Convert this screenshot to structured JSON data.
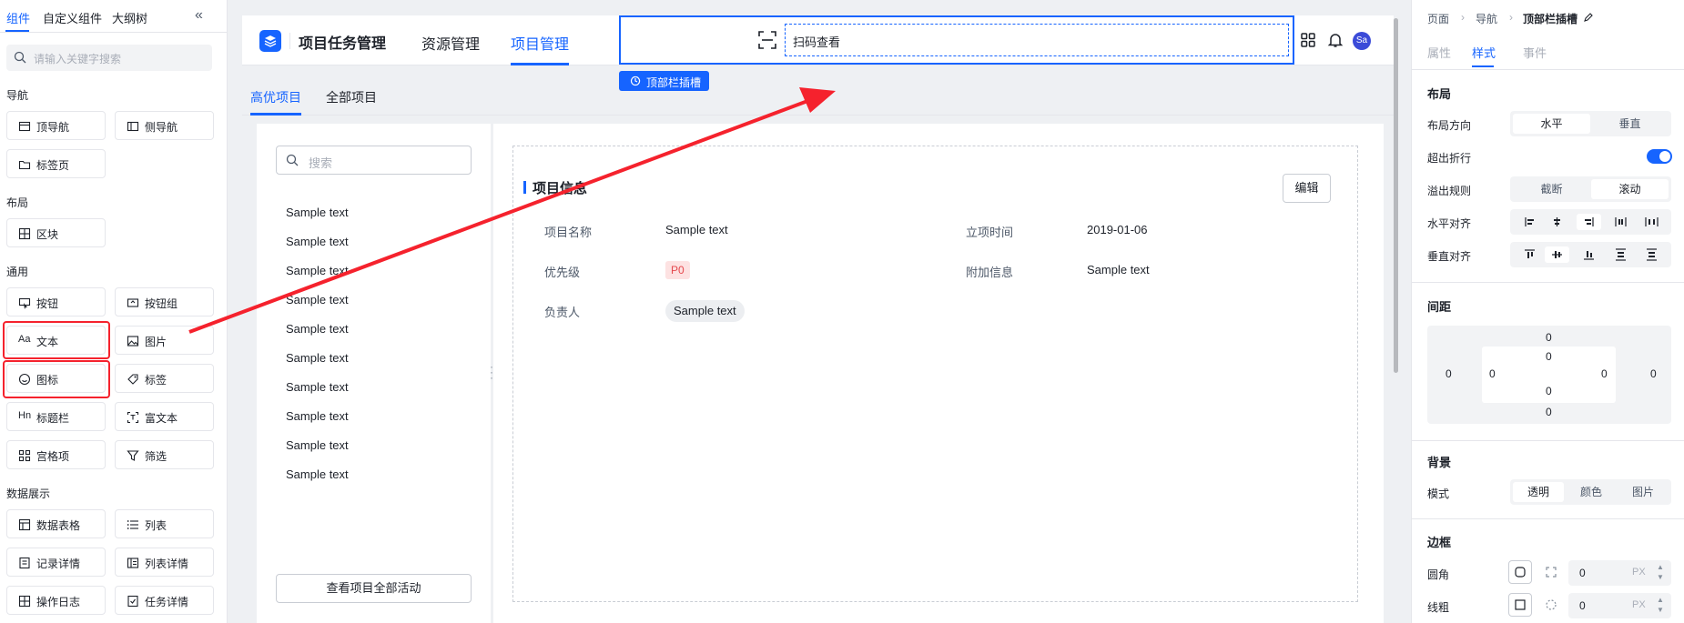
{
  "left_panel": {
    "tabs": [
      "组件",
      "自定义组件",
      "大纲树"
    ],
    "search_placeholder": "请输入关键字搜索",
    "sections": {
      "nav": "导航",
      "layout": "布局",
      "general": "通用",
      "data_display": "数据展示"
    },
    "components": {
      "top_nav": "顶导航",
      "side_nav": "侧导航",
      "tab_page": "标签页",
      "block": "区块",
      "button": "按钮",
      "button_group": "按钮组",
      "text": "文本",
      "image": "图片",
      "icon": "图标",
      "tag": "标签",
      "title_bar": "标题栏",
      "rich_text": "富文本",
      "grid_item": "宫格项",
      "filter": "筛选",
      "data_table": "数据表格",
      "list": "列表",
      "record_detail": "记录详情",
      "list_detail": "列表详情",
      "op_log": "操作日志",
      "task_detail": "任务详情"
    }
  },
  "header": {
    "app_title": "项目任务管理",
    "nav": [
      "资源管理",
      "项目管理"
    ],
    "scan_text": "扫码查看",
    "avatar": "Sa",
    "slot_tag": "顶部栏插槽"
  },
  "content_tabs": [
    "高优项目",
    "全部项目"
  ],
  "list_panel": {
    "search_placeholder": "搜索",
    "items": [
      "Sample text",
      "Sample text",
      "Sample text",
      "Sample text",
      "Sample text",
      "Sample text",
      "Sample text",
      "Sample text",
      "Sample text",
      "Sample text"
    ],
    "all_button": "查看项目全部活动"
  },
  "detail": {
    "section_title": "项目信息",
    "edit": "编辑",
    "fields": {
      "name_label": "项目名称",
      "name_value": "Sample text",
      "date_label": "立项时间",
      "date_value": "2019-01-06",
      "priority_label": "优先级",
      "priority_value": "P0",
      "extra_label": "附加信息",
      "extra_value": "Sample text",
      "owner_label": "负责人",
      "owner_value": "Sample text"
    }
  },
  "right_panel": {
    "breadcrumb": [
      "页面",
      "导航",
      "顶部栏插槽"
    ],
    "tabs": [
      "属性",
      "样式",
      "事件"
    ],
    "layout": {
      "title": "布局",
      "direction_label": "布局方向",
      "direction_options": [
        "水平",
        "垂直"
      ],
      "wrap_label": "超出折行",
      "wrap_on": true,
      "overflow_label": "溢出规则",
      "overflow_options": [
        "截断",
        "滚动"
      ],
      "h_align_label": "水平对齐",
      "v_align_label": "垂直对齐"
    },
    "spacing": {
      "title": "间距",
      "values": [
        "0",
        "0",
        "0",
        "0",
        "0",
        "0",
        "0",
        "0"
      ]
    },
    "background": {
      "title": "背景",
      "mode_label": "模式",
      "mode_options": [
        "透明",
        "颜色",
        "图片"
      ]
    },
    "border": {
      "title": "边框",
      "radius_label": "圆角",
      "radius_value": "0",
      "width_label": "线粗",
      "width_value": "0",
      "unit": "PX"
    }
  },
  "colors": {
    "accent": "#1664ff",
    "highlight": "#f5222d"
  }
}
